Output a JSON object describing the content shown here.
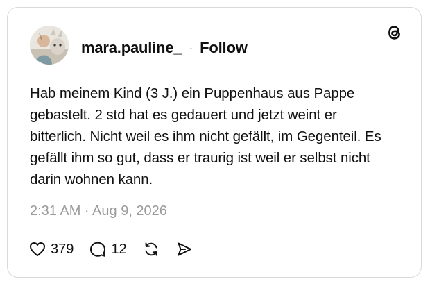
{
  "post": {
    "username": "mara.pauline_",
    "separator": "·",
    "follow_label": "Follow",
    "text": "Hab meinem Kind (3 J.) ein Puppenhaus aus Pappe gebastelt. 2 std hat es gedauert und jetzt weint er bitterlich. Nicht weil es ihm nicht gefällt, im Gegenteil. Es gefällt ihm so gut, dass er traurig ist weil er selbst nicht darin wohnen kann.",
    "timestamp": "2:31 AM · Aug 9, 2026",
    "likes": "379",
    "replies": "12"
  },
  "icons": {
    "brand": "threads-logo-icon",
    "like": "heart-icon",
    "reply": "comment-bubble-icon",
    "repost": "repost-icon",
    "share": "send-icon"
  },
  "colors": {
    "text": "#101010",
    "muted": "#9a9a9a",
    "border": "#d9d9d9"
  }
}
